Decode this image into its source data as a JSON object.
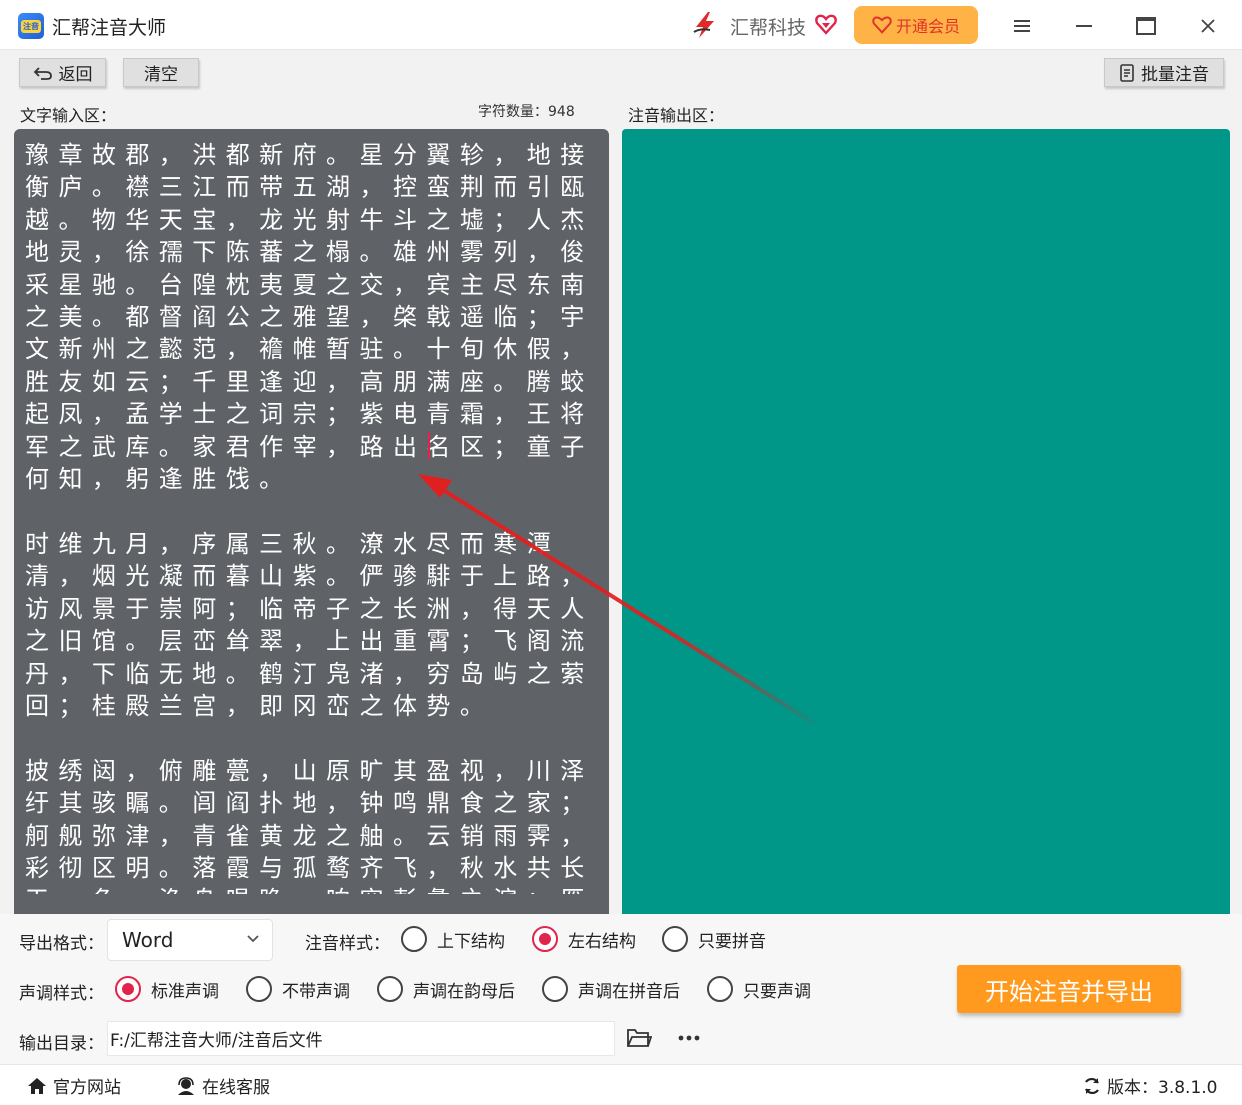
{
  "titlebar": {
    "app_title": "汇帮注音大师",
    "app_logo_text": "注音",
    "brand_name": "汇帮科技",
    "vip_label": "开通会员"
  },
  "toolbar": {
    "back_label": "返回",
    "clear_label": "清空",
    "batch_label": "批量注音"
  },
  "input": {
    "label": "文字输入区：",
    "char_count": "字符数量：948",
    "text": "豫章故郡，洪都新府。星分翼轸，地接衡庐。襟三江而带五湖，控蛮荆而引瓯越。物华天宝，龙光射牛斗之墟；人杰地灵，徐孺下陈蕃之榻。雄州雾列，俊采星驰。台隍枕夷夏之交，宾主尽东南之美。都督阎公之雅望，棨戟遥临；宇文新州之懿范，襜帷暂驻。十旬休假，胜友如云；千里逢迎，高朋满座。腾蛟起凤，孟学士之词宗；紫电青霜，王将军之武库。家君作宰，路出名区；童子何知，躬逢胜饯。\n\n时维九月，序属三秋。潦水尽而寒潭清，烟光凝而暮山紫。俨骖騑于上路，访风景于崇阿；临帝子之长洲，得天人之旧馆。层峦耸翠，上出重霄；飞阁流丹，下临无地。鹤汀凫渚，穷岛屿之萦回；桂殿兰宫，即冈峦之体势。\n\n披绣闼，俯雕甍，山原旷其盈视，川泽纡其骇瞩。闾阎扑地，钟鸣鼎食之家；舸舰弥津，青雀黄龙之舳。云销雨霁，彩彻区明。落霞与孤鹜齐飞，秋水共长天一色。渔舟唱晚，响穷彭蠡之滨；雁阵惊寒，声断衡阳之浦。"
  },
  "output": {
    "label": "注音输出区："
  },
  "settings": {
    "export_format_label": "导出格式：",
    "export_format_value": "Word",
    "annotation_style_label": "注音样式：",
    "annotation_options": [
      "上下结构",
      "左右结构",
      "只要拼音"
    ],
    "tone_style_label": "声调样式：",
    "tone_options": [
      "标准声调",
      "不带声调",
      "声调在韵母后",
      "声调在拼音后",
      "只要声调"
    ],
    "output_dir_label": "输出目录：",
    "output_dir_value": "F:/汇帮注音大师/注音后文件",
    "start_label": "开始注音并导出"
  },
  "footer": {
    "website_label": "官方网站",
    "service_label": "在线客服",
    "version_label": "版本：3.8.1.0"
  },
  "colors": {
    "output_bg": "#009688",
    "input_bg": "#5f6368",
    "accent": "#ff9a1e",
    "radio_selected": "#e0244a",
    "arrow": "#e02020"
  }
}
